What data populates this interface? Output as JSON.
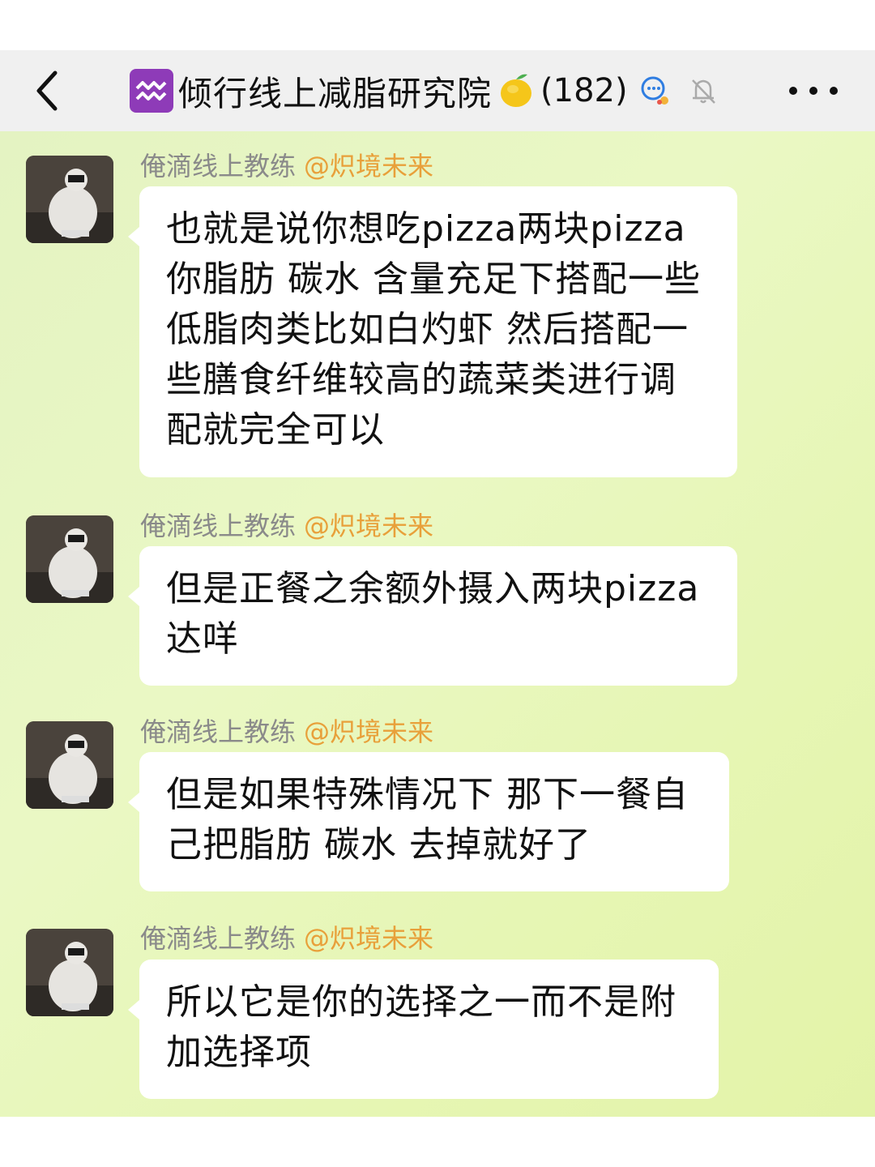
{
  "header": {
    "title": "倾行线上减脂研究院",
    "member_count": "(182)"
  },
  "messages": [
    {
      "sender": "俺滴线上教练",
      "tag": "@炽境未来",
      "text_lines": [
        "也就是说你想吃pizza两块pizza",
        "你脂肪 碳水 含量充足下搭配一些",
        "低脂肉类比如白灼虾 然后搭配一",
        "些膳食纤维较高的蔬菜类进行调",
        "配就完全可以"
      ]
    },
    {
      "sender": "俺滴线上教练",
      "tag": "@炽境未来",
      "text_lines": [
        "但是正餐之余额外摄入两块pizza",
        "达咩"
      ]
    },
    {
      "sender": "俺滴线上教练",
      "tag": "@炽境未来",
      "text_lines": [
        "但是如果特殊情况下 那下一餐自",
        "己把脂肪 碳水 去掉就好了"
      ]
    },
    {
      "sender": "俺滴线上教练",
      "tag": "@炽境未来",
      "text_lines": [
        "所以它是你的选择之一而不是附",
        "加选择项"
      ]
    }
  ],
  "icons": {
    "back": "chevron-left-icon",
    "zodiac": "aquarius-icon",
    "lemon": "lemon-icon",
    "chat": "group-chat-icon",
    "mute": "bell-muted-icon",
    "more": "more-dots-icon"
  },
  "colors": {
    "header_bg": "#f0f0f0",
    "chat_bg": "#e6f6b8",
    "tag_color": "#e8a03a",
    "sender_color": "#8a8a8a"
  }
}
